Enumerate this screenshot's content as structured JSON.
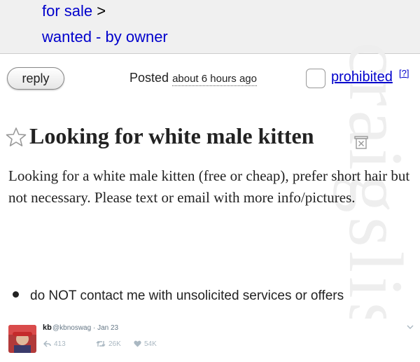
{
  "breadcrumbs": {
    "item1": "for sale",
    "item1_sep": ">",
    "item2": "wanted - by owner"
  },
  "watermark": "craigslist",
  "toolbar": {
    "reply_label": "reply",
    "posted_label": "Posted",
    "posted_ago": "about 6 hours ago",
    "prohibited_label": "prohibited",
    "help_label": "[?]"
  },
  "posting": {
    "title": "Looking for white male kitten",
    "body": "Looking for a white male kitten (free or cheap), prefer short hair but not necessary. Please text or email with more info/pictures.",
    "notice": "do NOT contact me with unsolicited services or offers"
  },
  "tweet": {
    "name": "kb",
    "handle_date": "@kbnoswag · Jan 23",
    "replies": "413",
    "retweets": "26K",
    "likes": "54K"
  },
  "colors": {
    "link": "#0000cc",
    "breadcrumb_bg": "#f0f0f0",
    "text": "#222222",
    "tweet_meta": "#aab8c2"
  }
}
